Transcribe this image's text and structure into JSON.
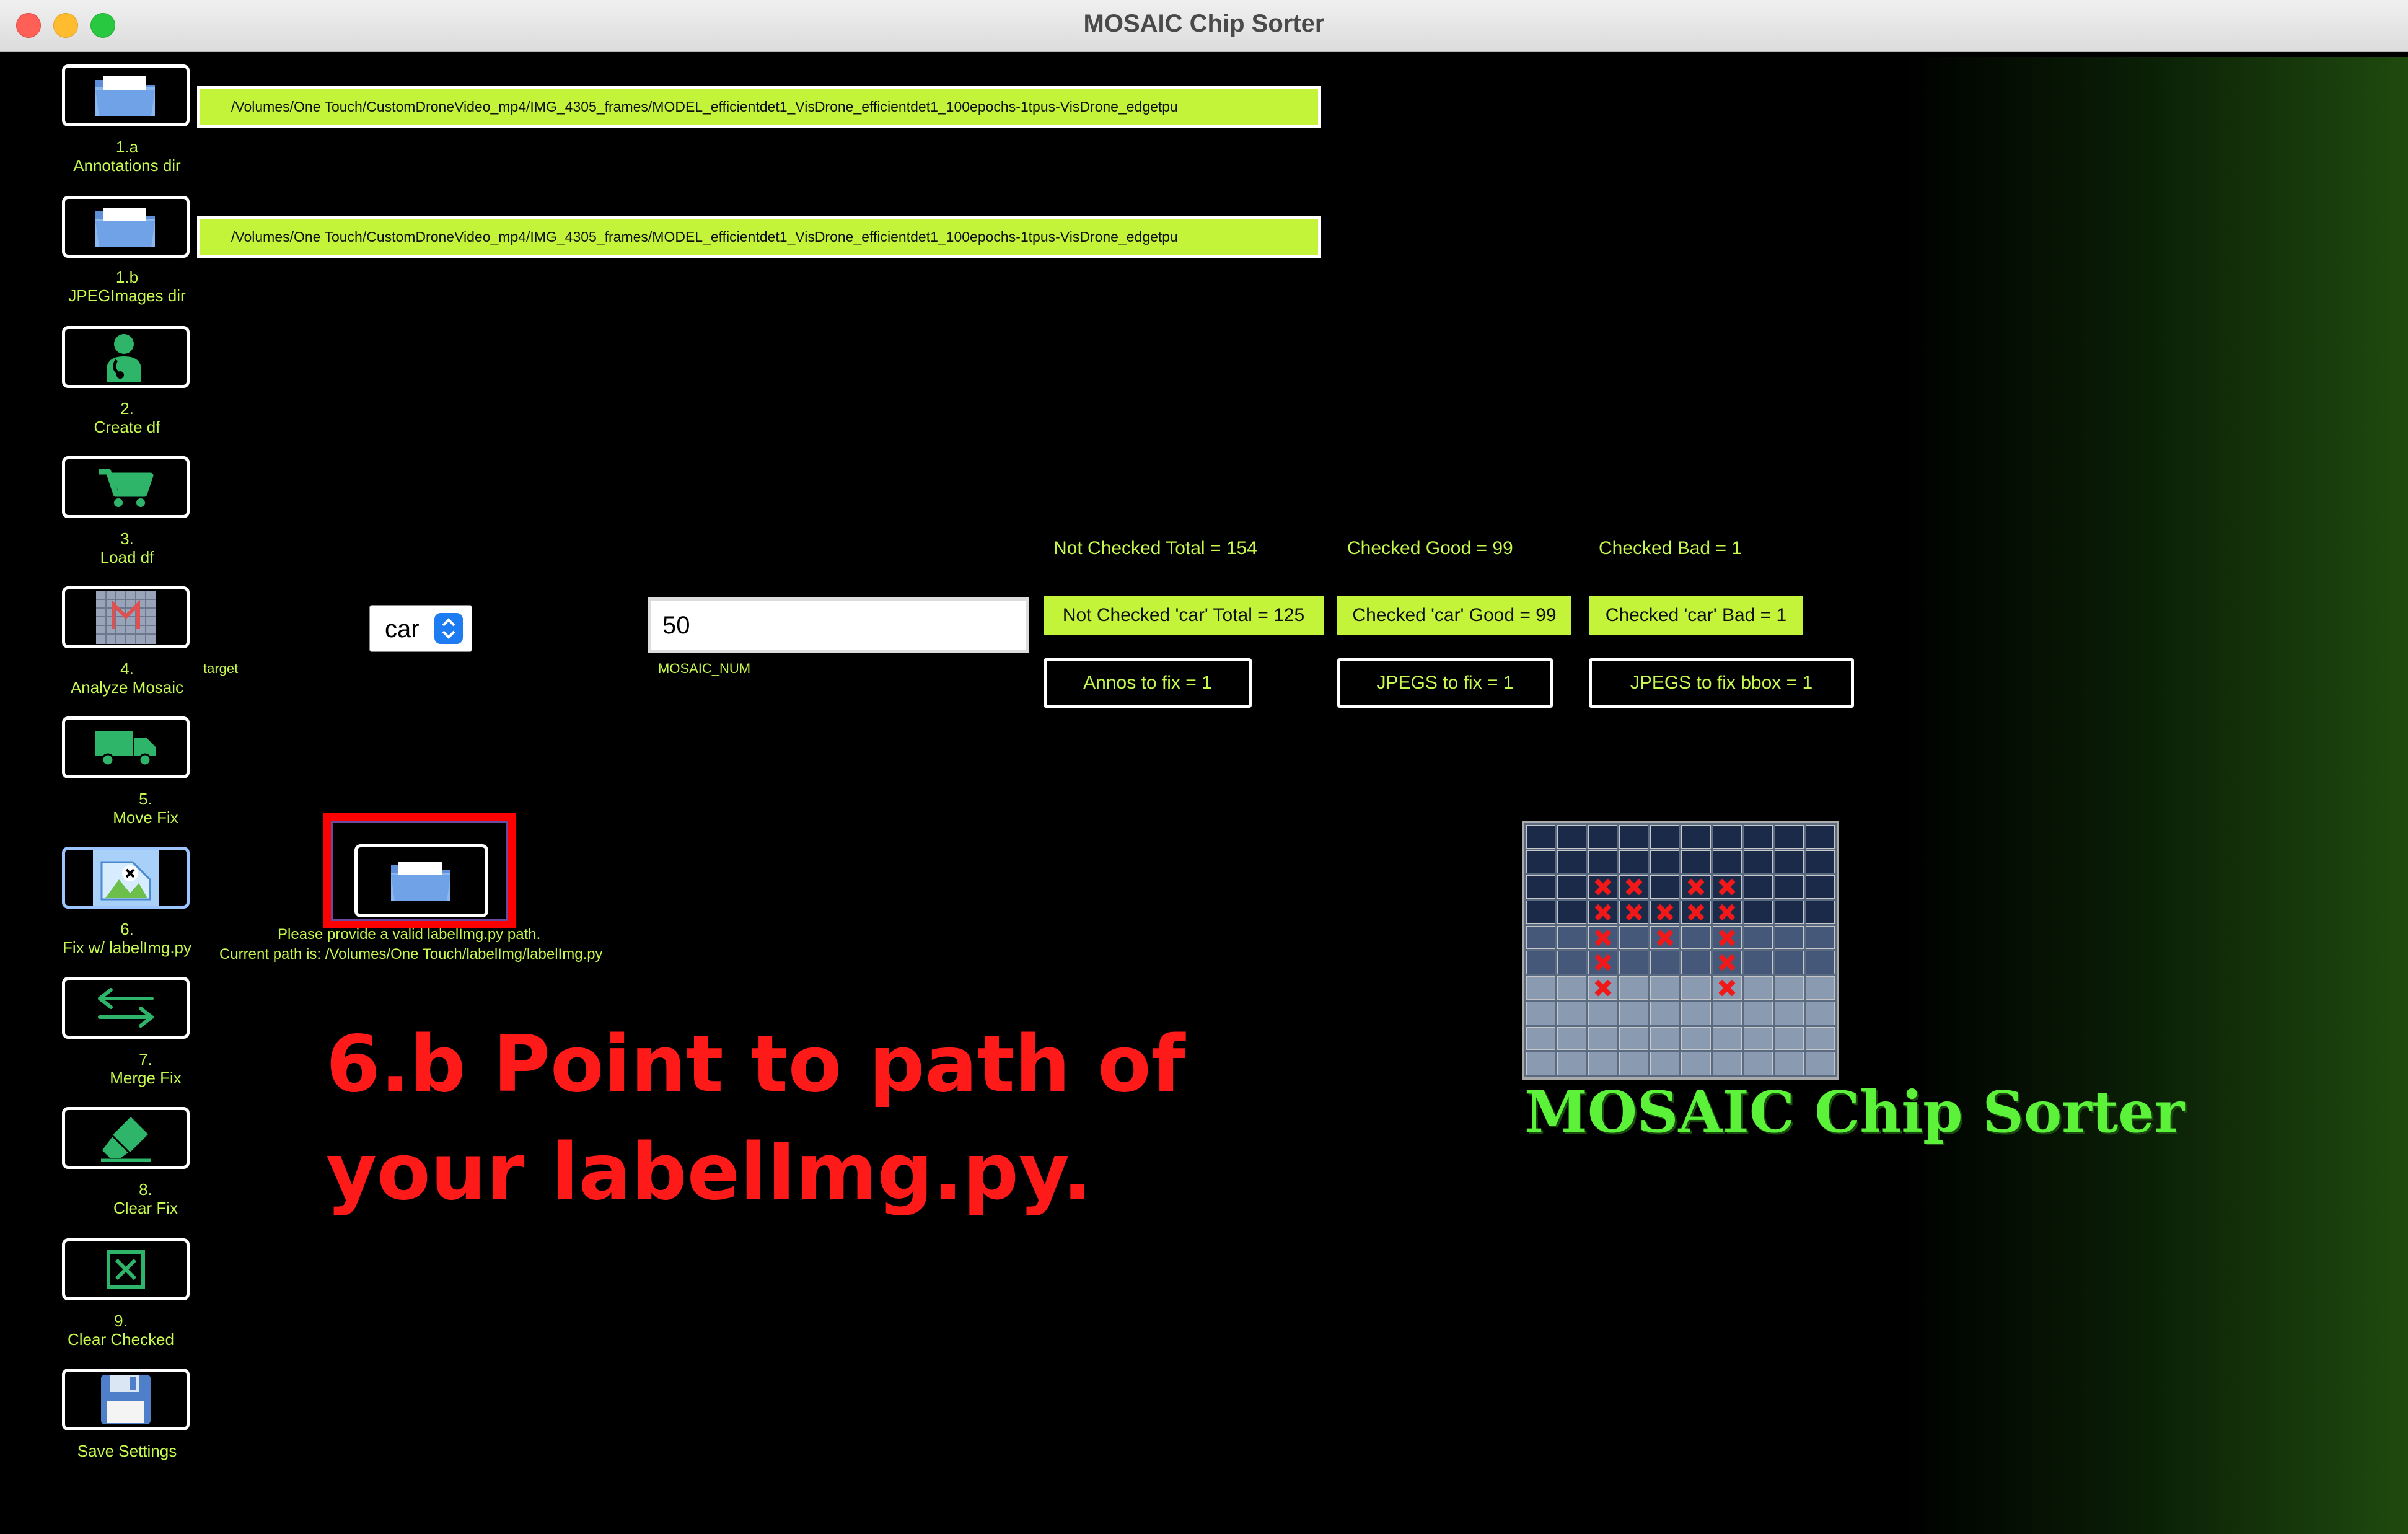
{
  "window": {
    "title": "MOSAIC Chip Sorter"
  },
  "paths": {
    "annotations_dir": "/Volumes/One Touch/CustomDroneVideo_mp4/IMG_4305_frames/MODEL_efficientdet1_VisDrone_efficientdet1_100epochs-1tpus-VisDrone_edgetpu",
    "jpegimages_dir": "/Volumes/One Touch/CustomDroneVideo_mp4/IMG_4305_frames/MODEL_efficientdet1_VisDrone_efficientdet1_100epochs-1tpus-VisDrone_edgetpu"
  },
  "toolbar": [
    {
      "num": "1.a",
      "label": "Annotations dir",
      "icon": "folder-icon"
    },
    {
      "num": "1.b",
      "label": "JPEGImages dir",
      "icon": "folder-icon"
    },
    {
      "num": "2.",
      "label": "Create df",
      "icon": "doctor-icon"
    },
    {
      "num": "3.",
      "label": "Load df",
      "icon": "cart-icon"
    },
    {
      "num": "4.",
      "label": "Analyze Mosaic",
      "icon": "mosaic-icon"
    },
    {
      "num": "5.",
      "label": "Move Fix",
      "icon": "truck-icon"
    },
    {
      "num": "6.",
      "label": "Fix w/ labelImg.py",
      "icon": "label-image-icon"
    },
    {
      "num": "7.",
      "label": "Merge Fix",
      "icon": "arrows-icon"
    },
    {
      "num": "8.",
      "label": "Clear Fix",
      "icon": "eraser-icon"
    },
    {
      "num": "9.",
      "label": "Clear Checked",
      "icon": "checkbox-x-icon"
    },
    {
      "num": "",
      "label": "Save Settings",
      "icon": "floppy-icon"
    }
  ],
  "target": {
    "label": "target",
    "selected": "car"
  },
  "mosaic_num": {
    "label": "MOSAIC_NUM",
    "value": "50"
  },
  "stats": {
    "not_checked_total": "Not Checked Total = 154",
    "checked_good": "Checked Good = 99",
    "checked_bad": "Checked Bad = 1",
    "not_checked_car_total": "Not Checked 'car' Total = 125",
    "checked_car_good": "Checked 'car' Good = 99",
    "checked_car_bad": "Checked 'car' Bad = 1",
    "annos_to_fix": "Annos to fix = 1",
    "jpegs_to_fix": "JPEGS to fix = 1",
    "jpegs_to_fix_bbox": "JPEGS to fix bbox = 1"
  },
  "labelimg": {
    "hint_line1": "Please provide a valid labelImg.py path.",
    "hint_line2": "Current path is: /Volumes/One Touch/labelImg/labelImg.py"
  },
  "annotation": {
    "line1": "6.b  Point to path of",
    "line2": "your labelImg.py."
  },
  "brand": {
    "text": "MOSAIC Chip Sorter"
  },
  "colors": {
    "accent": "#c3f43a",
    "label_text": "#c6f84e",
    "annotation": "#ff1a1a",
    "highlight": "#ff0000"
  }
}
